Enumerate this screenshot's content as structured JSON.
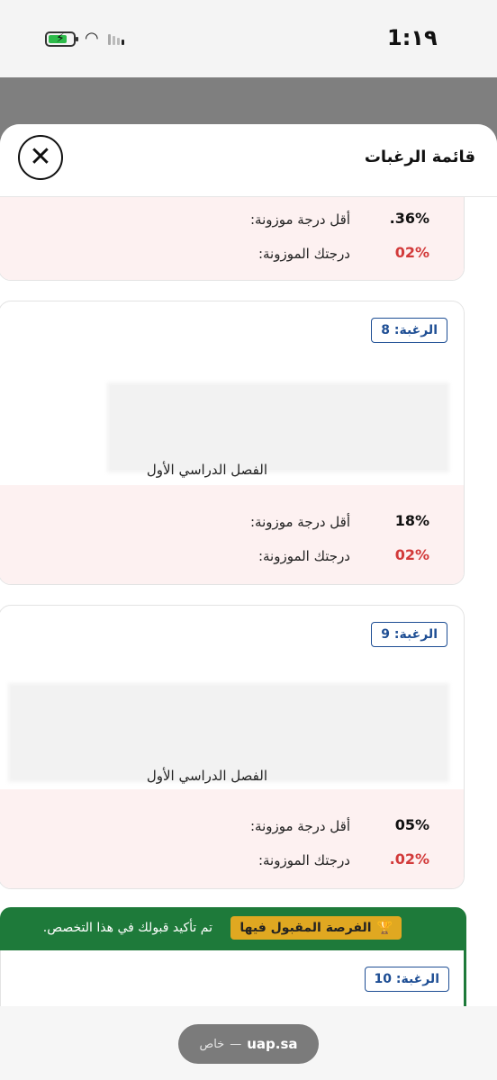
{
  "status_bar": {
    "time": "1:١٩"
  },
  "sheet": {
    "title": "قائمة الرغبات"
  },
  "cards": [
    {
      "min_label": "أقل درجة موزونة:",
      "min_value": ".36%",
      "your_label": "درجتك الموزونة:",
      "your_value": "02%"
    },
    {
      "badge": "الرغبة: 8",
      "semester": "الفصل الدراسي الأول",
      "min_label": "أقل درجة موزونة:",
      "min_value": "18%",
      "your_label": "درجتك الموزونة:",
      "your_value": "02%"
    },
    {
      "badge": "الرغبة: 9",
      "semester": "الفصل الدراسي الأول",
      "min_label": "أقل درجة موزونة:",
      "min_value": "05%",
      "your_label": "درجتك الموزونة:",
      "your_value": ".02%"
    }
  ],
  "accepted": {
    "label": "الفرصة المقبول فيها",
    "text": "تم تأكيد قبولك في هذا التخصص."
  },
  "card10": {
    "badge": "الرغبة: 10"
  },
  "browser": {
    "domain": "uap.sa",
    "mode": "خاص",
    "separator": "—"
  },
  "colors": {
    "accent_blue": "#1e4e94",
    "accepted_green": "#1e7a3a",
    "badge_gold": "#e0a821",
    "value_red": "#d23a3a"
  }
}
